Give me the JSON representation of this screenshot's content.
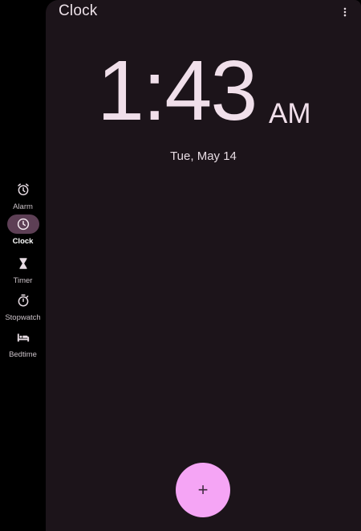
{
  "app": {
    "title": "Clock",
    "accent_color": "#f5a5f5",
    "selected_indicator_color": "#5d3f55"
  },
  "nav": {
    "items": [
      {
        "label": "Alarm",
        "icon": "alarm-clock-icon",
        "selected": false
      },
      {
        "label": "Clock",
        "icon": "clock-icon",
        "selected": true
      },
      {
        "label": "Timer",
        "icon": "hourglass-icon",
        "selected": false
      },
      {
        "label": "Stopwatch",
        "icon": "stopwatch-icon",
        "selected": false
      },
      {
        "label": "Bedtime",
        "icon": "bed-icon",
        "selected": false
      }
    ]
  },
  "clock": {
    "time": "1:43",
    "ampm": "AM",
    "date": "Tue, May 14"
  },
  "toolbar": {
    "overflow_icon": "more-vert-icon"
  },
  "fab": {
    "icon": "add-icon",
    "symbol": "+"
  }
}
